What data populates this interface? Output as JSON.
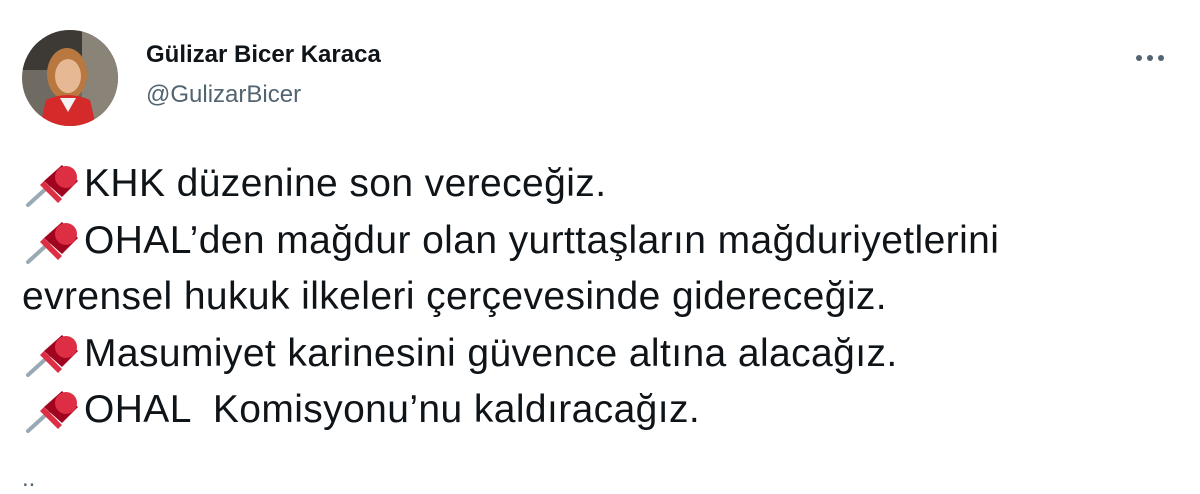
{
  "author": {
    "name": "Gülizar Bicer Karaca",
    "handle": "@GulizarBicer",
    "avatar_icon": "profile-photo"
  },
  "menu": {
    "icon": "more-dots-icon"
  },
  "tweet": {
    "marker_icon": "pushpin-icon",
    "lines": [
      {
        "pin": true,
        "text": "KHK düzenine son vereceğiz."
      },
      {
        "pin": true,
        "text": "OHAL’den mağdur olan yurttaşların mağduriyetlerini"
      },
      {
        "pin": false,
        "text": "evrensel hukuk ilkeleri çerçevesinde gidereceğiz."
      },
      {
        "pin": true,
        "text": "Masumiyet karinesini güvence altına alacağız."
      },
      {
        "pin": true,
        "text": "OHAL  Komisyonu’nu kaldıracağız."
      }
    ]
  },
  "colors": {
    "text": "#0f1419",
    "secondary": "#536471",
    "pin_red": "#dd2e44",
    "pin_dark": "#a0041e"
  }
}
